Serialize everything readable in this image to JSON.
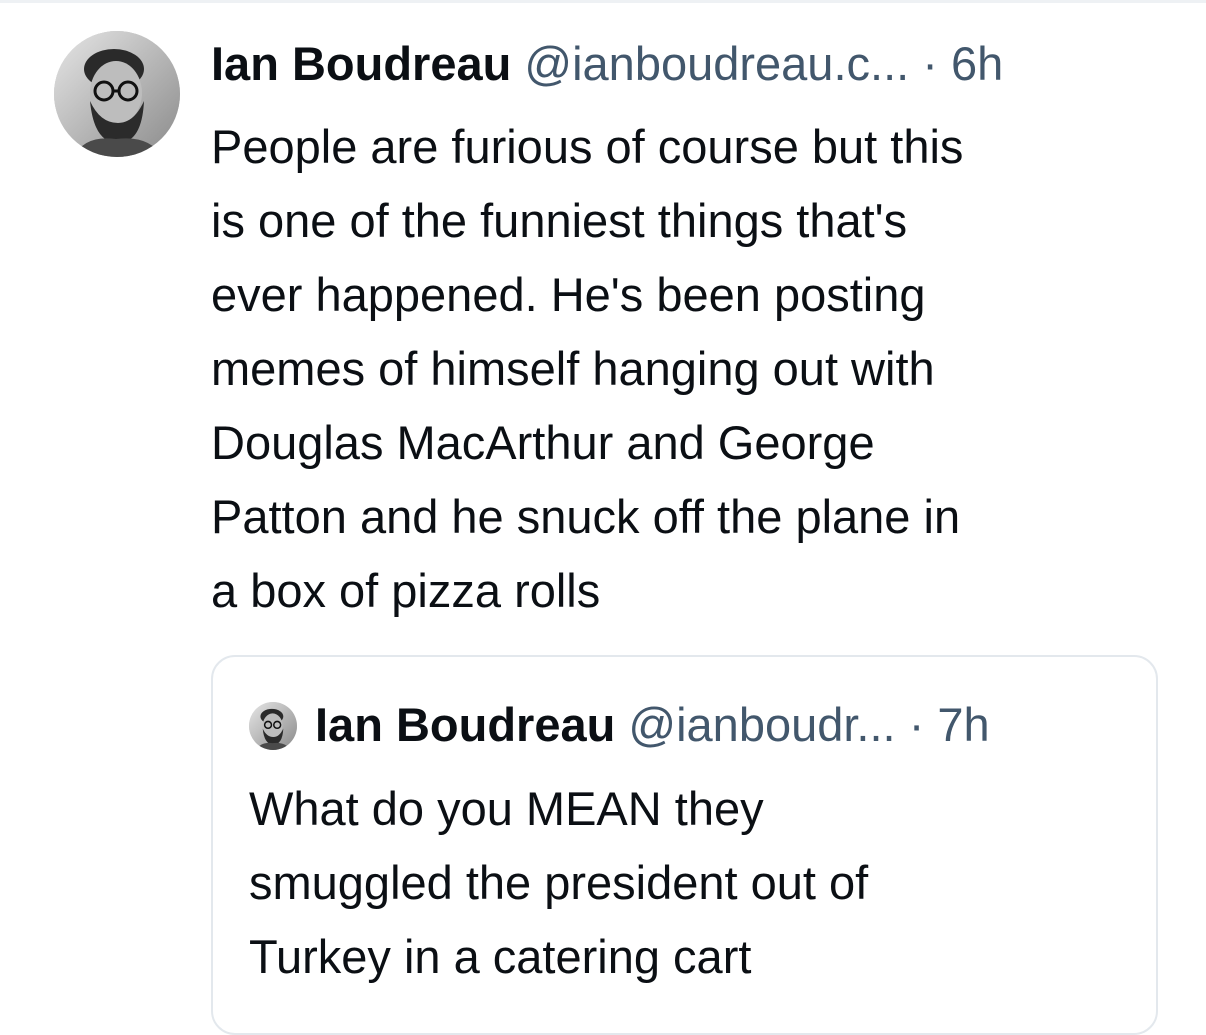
{
  "post": {
    "author": {
      "display_name": "Ian Boudreau",
      "handle": "@ianboudreau.c...",
      "avatar_icon": "avatar-photo-icon"
    },
    "separator": "·",
    "timestamp": "6h",
    "body_lines": [
      "People are furious of course but this",
      "is one of the funniest things that's",
      "ever happened. He's been posting",
      "memes of himself hanging out with",
      "Douglas MacArthur and George",
      "Patton and he snuck off the plane in",
      "a box of pizza rolls"
    ]
  },
  "quote": {
    "author": {
      "display_name": "Ian Boudreau",
      "handle": "@ianboudr...",
      "avatar_icon": "avatar-photo-icon"
    },
    "separator": "·",
    "timestamp": "7h",
    "body_lines": [
      "What do you MEAN they",
      "smuggled the president out of",
      "Turkey in a catering cart"
    ]
  },
  "colors": {
    "text_primary": "#0b0f14",
    "text_secondary": "#42576c",
    "border": "#e3e8ed"
  }
}
